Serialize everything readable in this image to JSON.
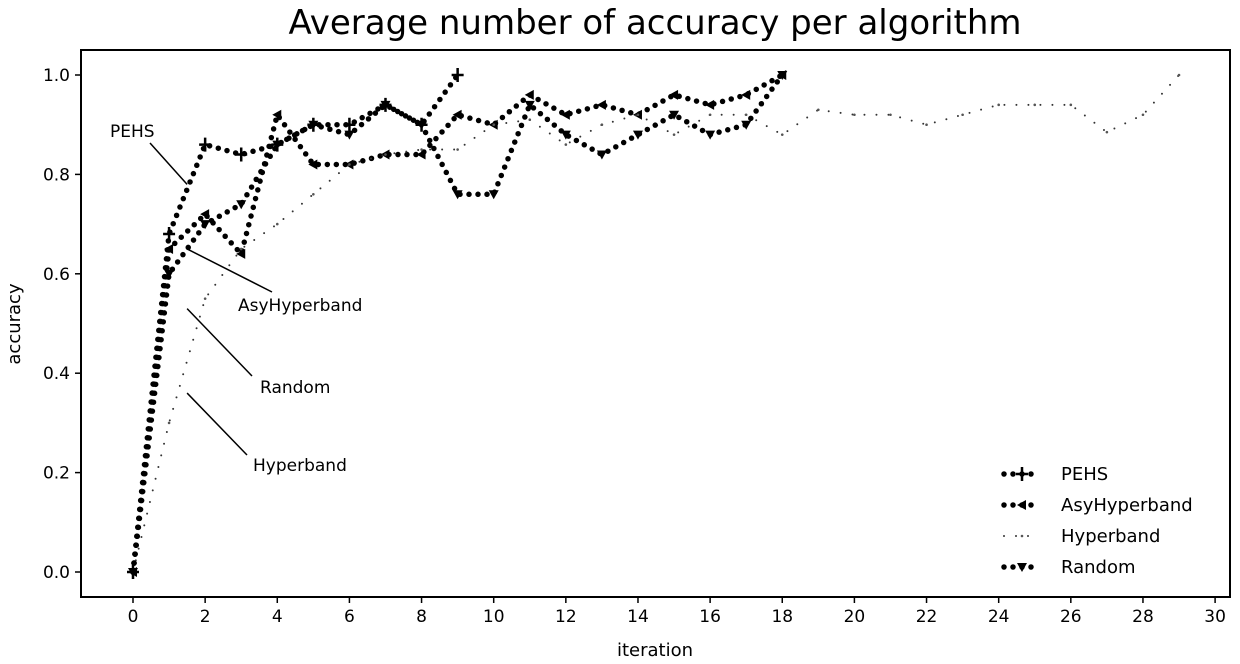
{
  "chart_data": {
    "type": "line",
    "title": "Average number of accuracy per algorithm",
    "xlabel": "iteration",
    "ylabel": "accuracy",
    "xlim": [
      -1.5,
      30.5
    ],
    "ylim": [
      -0.05,
      1.05
    ],
    "xticks": [
      0,
      2,
      4,
      6,
      8,
      10,
      12,
      14,
      16,
      18,
      20,
      22,
      24,
      26,
      28,
      30
    ],
    "xtick_labels": [
      "0",
      "2",
      "4",
      "6",
      "8",
      "10",
      "12",
      "14",
      "16",
      "18",
      "20",
      "22",
      "24",
      "26",
      "28",
      "30"
    ],
    "yticks": [
      0.0,
      0.2,
      0.4,
      0.6,
      0.8,
      1.0
    ],
    "ytick_labels": [
      "0.0",
      "0.2",
      "0.4",
      "0.6",
      "0.8",
      "1.0"
    ],
    "grid": false,
    "legend_position": "bottom-right",
    "series": [
      {
        "name": "PEHS",
        "marker": "plus",
        "style": "dotted-heavy",
        "x": [
          0,
          1,
          2,
          3,
          4,
          5,
          6,
          7,
          8,
          9
        ],
        "values": [
          0.0,
          0.68,
          0.86,
          0.84,
          0.86,
          0.9,
          0.9,
          0.94,
          0.9,
          1.0
        ]
      },
      {
        "name": "AsyHyperband",
        "marker": "triangle-left",
        "style": "dotted-heavy",
        "x": [
          0,
          1,
          2,
          3,
          4,
          5,
          6,
          7,
          8,
          9,
          10,
          11,
          12,
          13,
          14,
          15,
          16,
          17,
          18
        ],
        "values": [
          0.0,
          0.65,
          0.72,
          0.64,
          0.92,
          0.82,
          0.82,
          0.84,
          0.84,
          0.92,
          0.9,
          0.96,
          0.92,
          0.94,
          0.92,
          0.96,
          0.94,
          0.96,
          1.0
        ]
      },
      {
        "name": "Hyperband",
        "marker": "dot-small",
        "style": "dotted-light",
        "x": [
          0,
          1,
          2,
          3,
          4,
          5,
          6,
          7,
          8,
          9,
          10,
          11,
          12,
          13,
          14,
          15,
          16,
          17,
          18,
          19,
          20,
          21,
          22,
          23,
          24,
          25,
          26,
          27,
          28,
          29
        ],
        "values": [
          0.0,
          0.3,
          0.55,
          0.65,
          0.7,
          0.76,
          0.82,
          0.84,
          0.85,
          0.85,
          0.9,
          0.91,
          0.86,
          0.9,
          0.92,
          0.88,
          0.92,
          0.92,
          0.88,
          0.93,
          0.92,
          0.92,
          0.9,
          0.92,
          0.94,
          0.94,
          0.94,
          0.885,
          0.92,
          1.0
        ]
      },
      {
        "name": "Random",
        "marker": "triangle-down",
        "style": "dotted-heavy",
        "x": [
          0,
          1,
          2,
          3,
          4,
          5,
          6,
          7,
          8,
          9,
          10,
          11,
          12,
          13,
          14,
          15,
          16,
          17,
          18
        ],
        "values": [
          0.0,
          0.6,
          0.7,
          0.74,
          0.86,
          0.9,
          0.88,
          0.94,
          0.9,
          0.76,
          0.76,
          0.94,
          0.88,
          0.84,
          0.88,
          0.92,
          0.88,
          0.9,
          1.0
        ]
      }
    ],
    "annotations": [
      {
        "text": "PEHS",
        "points_to": {
          "x": 1.5,
          "y": 0.78
        }
      },
      {
        "text": "AsyHyperband",
        "points_to": {
          "x": 1.5,
          "y": 0.65
        }
      },
      {
        "text": "Random",
        "points_to": {
          "x": 1.5,
          "y": 0.53
        }
      },
      {
        "text": "Hyperband",
        "points_to": {
          "x": 1.5,
          "y": 0.36
        }
      }
    ]
  }
}
